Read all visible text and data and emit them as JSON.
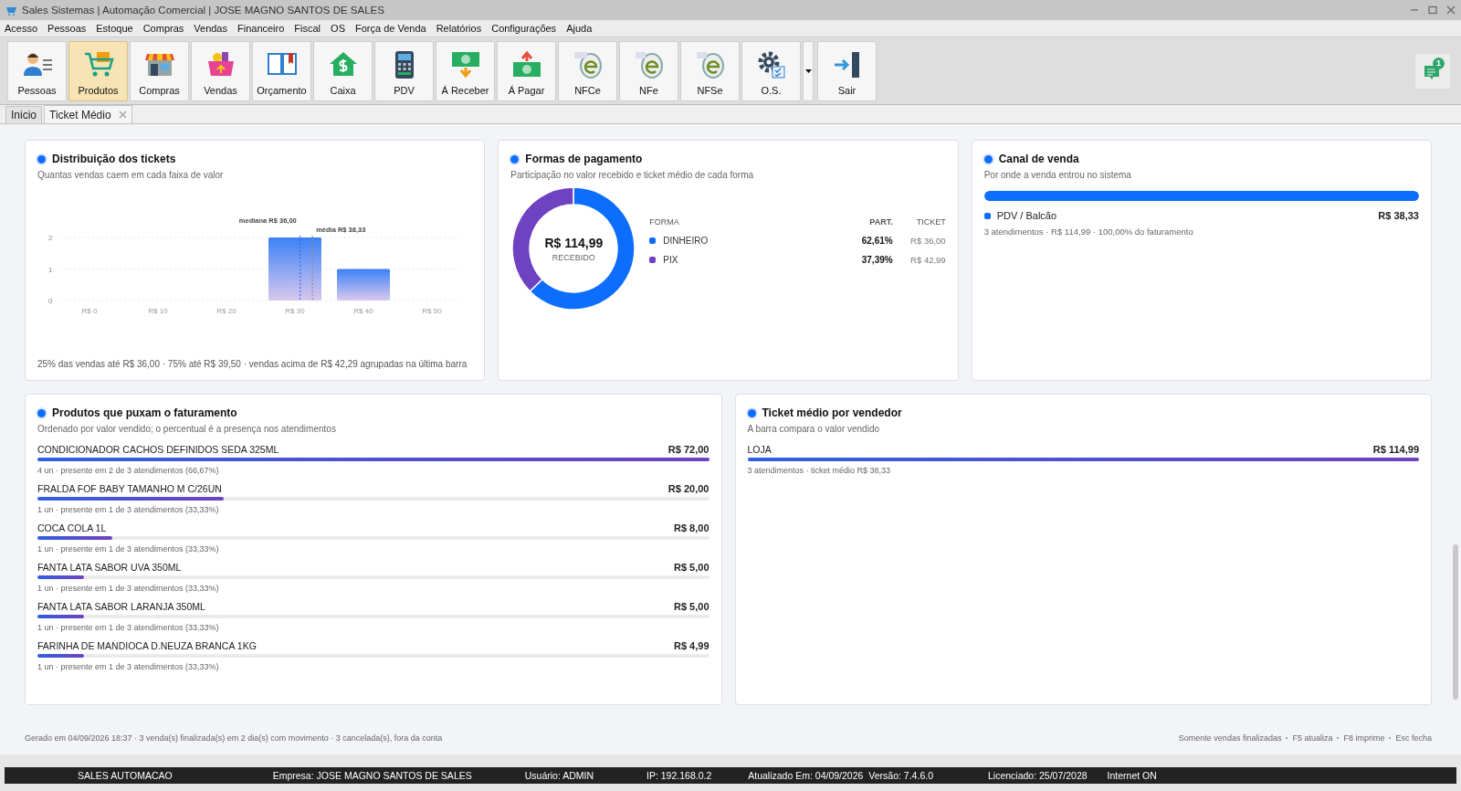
{
  "window": {
    "title": "Sales Sistemas | Automação Comercial | JOSE MAGNO SANTOS DE SALES"
  },
  "menu": [
    "Acesso",
    "Pessoas",
    "Estoque",
    "Compras",
    "Vendas",
    "Financeiro",
    "Fiscal",
    "OS",
    "Força de Venda",
    "Relatórios",
    "Configurações",
    "Ajuda"
  ],
  "toolbar": [
    {
      "label": "Pessoas",
      "selected": false
    },
    {
      "label": "Produtos",
      "selected": true
    },
    {
      "label": "Compras",
      "selected": false
    },
    {
      "label": "Vendas",
      "selected": false
    },
    {
      "label": "Orçamento",
      "selected": false
    },
    {
      "label": "Caixa",
      "selected": false
    },
    {
      "label": "PDV",
      "selected": false
    },
    {
      "label": "Á Receber",
      "selected": false
    },
    {
      "label": "Á Pagar",
      "selected": false
    },
    {
      "label": "NFCe",
      "selected": false
    },
    {
      "label": "NFe",
      "selected": false
    },
    {
      "label": "NFSe",
      "selected": false
    },
    {
      "label": "O.S.",
      "selected": false,
      "dropdown": true
    },
    {
      "label": "Sair",
      "selected": false
    }
  ],
  "notifications": {
    "count": "1"
  },
  "tabs": [
    {
      "label": "Inicio",
      "selected": false,
      "closable": false
    },
    {
      "label": "Ticket Médio",
      "selected": true,
      "closable": true
    }
  ],
  "distribution": {
    "title": "Distribuição dos tickets",
    "subtitle": "Quantas vendas caem em cada faixa de valor",
    "chart_data": {
      "type": "bar",
      "categories": [
        "R$ 0",
        "R$ 10",
        "R$ 20",
        "R$ 30",
        "R$ 40",
        "R$ 50"
      ],
      "series": [
        {
          "color": "#3b82f6",
          "values": [
            0,
            0,
            0,
            2,
            1,
            0
          ]
        }
      ],
      "ylim": [
        0,
        2
      ],
      "yticks": [
        0,
        1,
        2
      ],
      "annotations": [
        {
          "text": "mediana R$ 36,00"
        },
        {
          "text": "média R$ 38,33"
        }
      ]
    },
    "note": "25% das vendas até R$ 36,00 · 75% até R$ 39,50 · vendas acima de R$ 42,29 agrupadas na última barra"
  },
  "payments": {
    "title": "Formas de pagamento",
    "subtitle": "Participação no valor recebido e ticket médio de cada forma",
    "chart_data": {
      "type": "donut",
      "categories": [
        "DINHEIRO",
        "PIX"
      ],
      "values": [
        62.61,
        37.39
      ],
      "colors": [
        "#0d6efd",
        "#6f42c1"
      ]
    },
    "center_value": "R$ 114,99",
    "center_label": "RECEBIDO",
    "columns": [
      "FORMA",
      "PART.",
      "TICKET"
    ],
    "rows": [
      {
        "share": "62,61%",
        "ticket": "R$ 36,00",
        "color": "#0d6efd"
      },
      {
        "share": "37,39%",
        "ticket": "R$ 42,99",
        "color": "#6f42c1"
      }
    ]
  },
  "channels": {
    "title": "Canal de venda",
    "subtitle": "Por onde a venda entrou no sistema",
    "items": [
      {
        "name": "PDV / Balcão",
        "value": "R$ 38,33",
        "detail": "3 atendimentos · R$ 114,99 · 100,00% do faturamento",
        "level": 1,
        "color": "#0d6efd"
      }
    ]
  },
  "products": {
    "title": "Produtos que puxam o faturamento",
    "subtitle": "Ordenado por valor vendido; o percentual é a presença nos atendimentos",
    "items": [
      {
        "name": "CONDICIONADOR CACHOS DEFINIDOS SEDA 325ML",
        "value": "R$ 72,00",
        "level": 1,
        "detail": "4 un · presente em 2 de 3 atendimentos (66,67%)"
      },
      {
        "name": "FRALDA FOF BABY TAMANHO M C/26UN",
        "value": "R$ 20,00",
        "level": 0.278,
        "detail": "1 un · presente em 1 de 3 atendimentos (33,33%)"
      },
      {
        "name": "COCA COLA 1L",
        "value": "R$ 8,00",
        "level": 0.111,
        "detail": "1 un · presente em 1 de 3 atendimentos (33,33%)"
      },
      {
        "name": "FANTA LATA SABOR UVA 350ML",
        "value": "R$ 5,00",
        "level": 0.069,
        "detail": "1 un · presente em 1 de 3 atendimentos (33,33%)"
      },
      {
        "name": "FANTA LATA SABOR LARANJA 350ML",
        "value": "R$ 5,00",
        "level": 0.069,
        "detail": "1 un · presente em 1 de 3 atendimentos (33,33%)"
      },
      {
        "name": "FARINHA DE MANDIOCA D.NEUZA BRANCA 1KG",
        "value": "R$ 4,99",
        "level": 0.069,
        "detail": "1 un · presente em 1 de 3 atendimentos (33,33%)"
      }
    ]
  },
  "sellers": {
    "title": "Ticket médio por vendedor",
    "subtitle": "A barra compara o valor vendido",
    "items": [
      {
        "name": "LOJA",
        "value": "R$ 114,99",
        "level": 1,
        "detail": "3 atendimentos · ticket médio R$ 38,33"
      }
    ]
  },
  "footer": {
    "left": "Gerado em 04/09/2026 18:37 · 3 venda(s) finalizada(s) em 2 dia(s) com movimento · 3 cancelada(s), fora da conta",
    "right": [
      "Somente vendas finalizadas",
      "F5 atualiza",
      "F8 imprime",
      "Esc fecha"
    ]
  },
  "status_bar": [
    "SALES AUTOMACAO",
    "Empresa: JOSE MAGNO SANTOS DE SALES",
    "Usuário: ADMIN",
    "IP: 192.168.0.2",
    "Atualizado Em: 04/09/2026",
    "Versão: 7.4.6.0",
    "Licenciado: 25/07/2028",
    "Internet ON"
  ]
}
